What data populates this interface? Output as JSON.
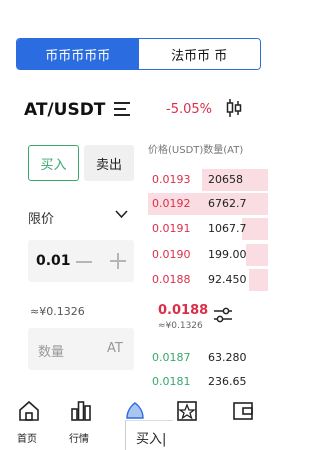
{
  "tabs": {
    "coin": "币币币币币",
    "fiat": "法币币 币"
  },
  "pair": {
    "symbol": "AT/USDT",
    "change": "-5.05%"
  },
  "trade": {
    "buy_label": "买入",
    "sell_label": "卖出",
    "order_type": "限价",
    "price": "0.01",
    "price_cny": "≈¥0.1326",
    "amount_placeholder": "数量",
    "amount_unit": "AT"
  },
  "orderbook": {
    "header": "价格(USDT)数量(AT)",
    "asks": [
      {
        "price": "0.0193",
        "amount": "20658",
        "depth": 0.55
      },
      {
        "price": "0.0192",
        "amount": "6762.7",
        "depth": 1.0
      },
      {
        "price": "0.0191",
        "amount": "1067.7",
        "depth": 0.22
      },
      {
        "price": "0.0190",
        "amount": "199.00",
        "depth": 0.18
      },
      {
        "price": "0.0188",
        "amount": "92.450",
        "depth": 0.16
      }
    ],
    "last_price": "0.0188",
    "last_price_cny": "≈¥0.1326",
    "bids": [
      {
        "price": "0.0187",
        "amount": "63.280"
      },
      {
        "price": "0.0181",
        "amount": "236.65"
      }
    ]
  },
  "nav": {
    "home": "首页",
    "market": "行情",
    "trade": "买入|"
  },
  "colors": {
    "accent": "#2b6de0",
    "up": "#3aa76d",
    "down": "#d9304a"
  }
}
